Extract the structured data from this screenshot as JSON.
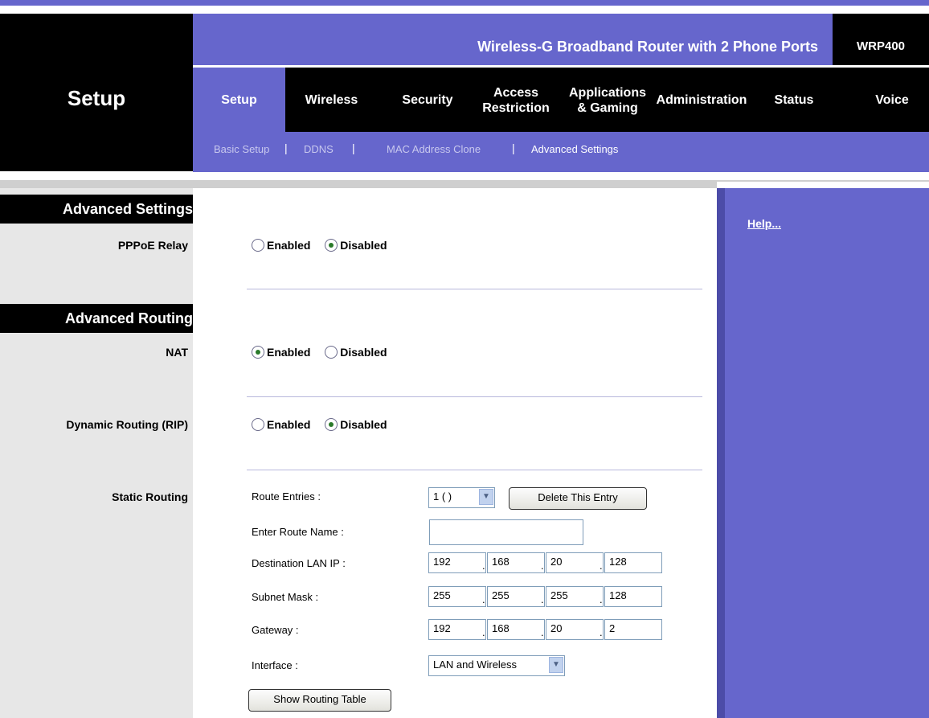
{
  "header": {
    "section_title": "Setup",
    "product_name": "Wireless-G Broadband Router with 2 Phone Ports",
    "model": "WRP400"
  },
  "nav": {
    "tabs": [
      {
        "line1": "Setup",
        "line2": ""
      },
      {
        "line1": "Wireless",
        "line2": ""
      },
      {
        "line1": "Security",
        "line2": ""
      },
      {
        "line1": "Access",
        "line2": "Restriction"
      },
      {
        "line1": "Applications",
        "line2": "& Gaming"
      },
      {
        "line1": "Administration",
        "line2": ""
      },
      {
        "line1": "Status",
        "line2": ""
      },
      {
        "line1": "Voice",
        "line2": ""
      }
    ],
    "active_tab": "Setup"
  },
  "subnav": {
    "items": [
      "Basic Setup",
      "DDNS",
      "MAC Address Clone",
      "Advanced Settings"
    ],
    "separator": "|",
    "active": "Advanced Settings"
  },
  "sidebar": {
    "advanced_settings": "Advanced Settings",
    "pppoe_relay": "PPPoE Relay",
    "advanced_routing": "Advanced Routing",
    "nat": "NAT",
    "dynamic_routing": "Dynamic Routing (RIP)",
    "static_routing": "Static Routing"
  },
  "options": {
    "enabled": "Enabled",
    "disabled": "Disabled"
  },
  "settings": {
    "pppoe_relay": "Disabled",
    "nat": "Enabled",
    "rip": "Disabled"
  },
  "static_routing": {
    "route_entries_label": "Route Entries :",
    "route_entries_value": "1 ( )",
    "delete_button": "Delete This Entry",
    "route_name_label": "Enter Route Name :",
    "route_name_value": "",
    "dest_ip_label": "Destination LAN IP :",
    "dest_ip": [
      "192",
      "168",
      "20",
      "128"
    ],
    "subnet_label": "Subnet Mask :",
    "subnet": [
      "255",
      "255",
      "255",
      "128"
    ],
    "gateway_label": "Gateway :",
    "gateway": [
      "192",
      "168",
      "20",
      "2"
    ],
    "interface_label": "Interface :",
    "interface_value": "LAN and Wireless",
    "show_table_button": "Show Routing Table"
  },
  "help": {
    "link": "Help..."
  },
  "colors": {
    "brand_purple": "#6666cc",
    "black": "#000000"
  }
}
